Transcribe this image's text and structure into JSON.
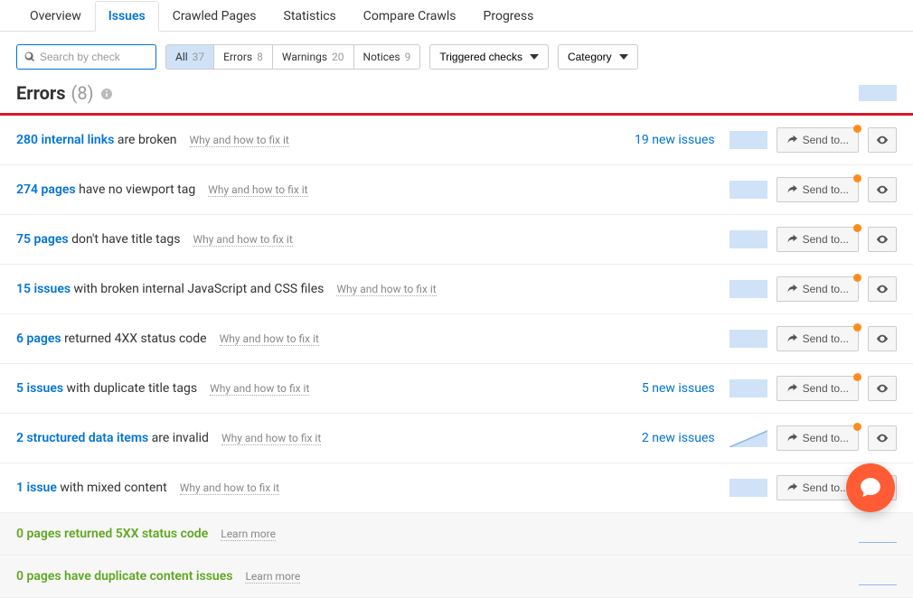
{
  "tabs": [
    "Overview",
    "Issues",
    "Crawled Pages",
    "Statistics",
    "Compare Crawls",
    "Progress"
  ],
  "active_tab": "Issues",
  "search": {
    "placeholder": "Search by check"
  },
  "chips": [
    {
      "label": "All",
      "count": "37",
      "active": true
    },
    {
      "label": "Errors",
      "count": "8"
    },
    {
      "label": "Warnings",
      "count": "20"
    },
    {
      "label": "Notices",
      "count": "9"
    }
  ],
  "dropdowns": {
    "triggered": "Triggered checks",
    "category": "Category"
  },
  "section": {
    "title": "Errors",
    "count": "(8)"
  },
  "fix_label": "Why and how to fix it",
  "learn_label": "Learn more",
  "send_label": "Send to...",
  "issues": [
    {
      "link": "280 internal links",
      "rest": "are broken",
      "new": "19 new issues",
      "hasBtns": true,
      "spark": "full"
    },
    {
      "link": "274 pages",
      "rest": "have no viewport tag",
      "new": "",
      "hasBtns": true,
      "spark": "full"
    },
    {
      "link": "75 pages",
      "rest": "don't have title tags",
      "new": "",
      "hasBtns": true,
      "spark": "full"
    },
    {
      "link": "15 issues",
      "rest": "with broken internal JavaScript and CSS files",
      "new": "",
      "hasBtns": true,
      "spark": "full"
    },
    {
      "link": "6 pages",
      "rest": "returned 4XX status code",
      "new": "",
      "hasBtns": true,
      "spark": "full"
    },
    {
      "link": "5 issues",
      "rest": "with duplicate title tags",
      "new": "5 new issues",
      "hasBtns": true,
      "spark": "full"
    },
    {
      "link": "2 structured data items",
      "rest": "are invalid",
      "new": "2 new issues",
      "hasBtns": true,
      "spark": "diag"
    },
    {
      "link": "1 issue",
      "rest": "with mixed content",
      "new": "",
      "hasBtns": true,
      "spark": "full"
    }
  ],
  "zero_issues": [
    {
      "link": "0 pages returned 5XX status code",
      "rest": ""
    },
    {
      "link": "0 pages have duplicate content issues",
      "rest": ""
    }
  ]
}
